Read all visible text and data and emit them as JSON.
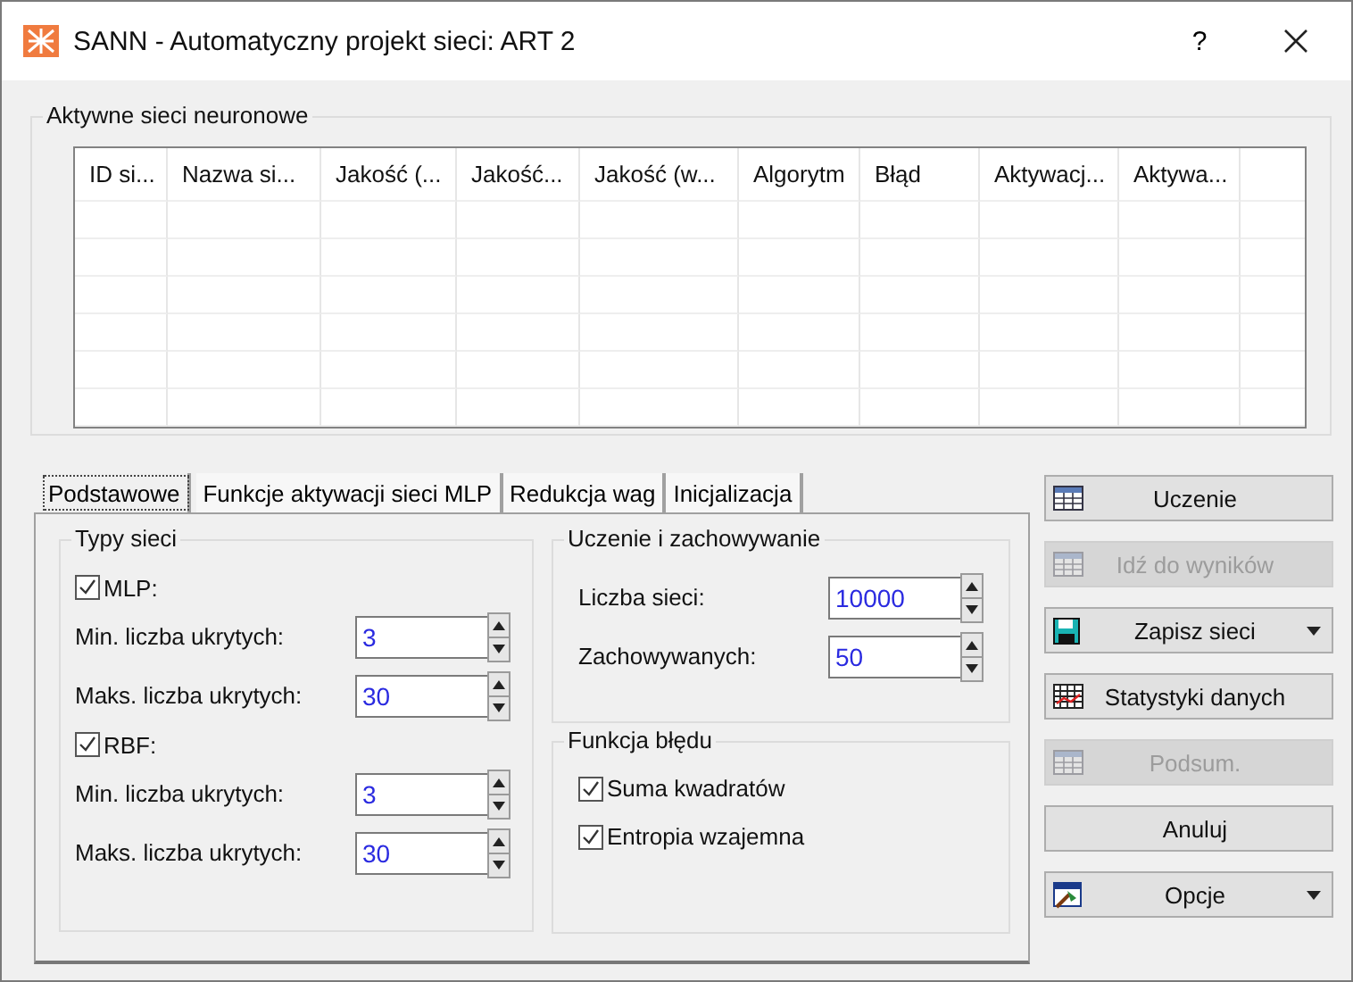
{
  "window": {
    "title": "SANN - Automatyczny projekt sieci: ART 2",
    "help": "?"
  },
  "networks": {
    "title": "Aktywne sieci neuronowe",
    "columns": [
      "ID si...",
      "Nazwa si...",
      "Jakość (...",
      "Jakość...",
      "Jakość (w...",
      "Algorytm",
      "Błąd",
      "Aktywacj...",
      "Aktywa..."
    ]
  },
  "tabs": [
    {
      "label": "Podstawowe",
      "selected": true
    },
    {
      "label": "Funkcje aktywacji sieci MLP",
      "selected": false
    },
    {
      "label": "Redukcja wag",
      "selected": false
    },
    {
      "label": "Inicjalizacja",
      "selected": false
    }
  ],
  "network_types": {
    "title": "Typy sieci",
    "types": [
      {
        "label": "MLP:",
        "checked": true,
        "fields": [
          {
            "label": "Min. liczba ukrytych:",
            "value": "3"
          },
          {
            "label": "Maks. liczba ukrytych:",
            "value": "30"
          }
        ]
      },
      {
        "label": "RBF:",
        "checked": true,
        "fields": [
          {
            "label": "Min. liczba ukrytych:",
            "value": "3"
          },
          {
            "label": "Maks. liczba ukrytych:",
            "value": "30"
          }
        ]
      }
    ]
  },
  "training": {
    "title": "Uczenie i zachowywanie",
    "fields": [
      {
        "label": "Liczba sieci:",
        "value": "10000"
      },
      {
        "label": "Zachowywanych:",
        "value": "50"
      }
    ]
  },
  "error_function": {
    "title": "Funkcja błędu",
    "options": [
      {
        "label": "Suma kwadratów",
        "checked": true
      },
      {
        "label": "Entropia wzajemna",
        "checked": true
      }
    ]
  },
  "buttons": [
    {
      "label": "Uczenie",
      "kind": "grid",
      "disabled": false,
      "dropdown": false
    },
    {
      "label": "Idź do wyników",
      "kind": "grid",
      "disabled": true,
      "dropdown": false
    },
    {
      "label": "Zapisz sieci",
      "kind": "disk",
      "disabled": false,
      "dropdown": true
    },
    {
      "label": "Statystyki danych",
      "kind": "chart",
      "disabled": false,
      "dropdown": false
    },
    {
      "label": "Podsum.",
      "kind": "grid",
      "disabled": true,
      "dropdown": false
    },
    {
      "label": "Anuluj",
      "kind": "plain",
      "disabled": false,
      "dropdown": false
    },
    {
      "label": "Opcje",
      "kind": "tool",
      "disabled": false,
      "dropdown": true
    }
  ]
}
